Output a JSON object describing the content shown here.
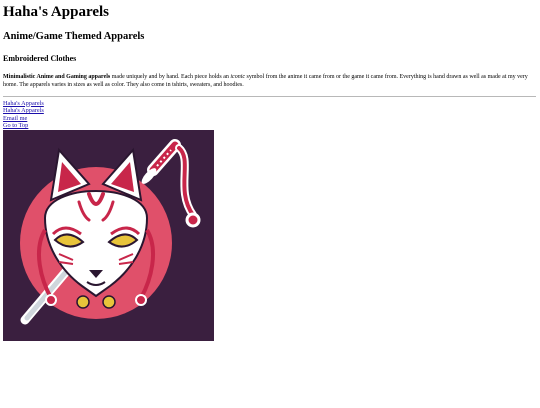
{
  "header": {
    "title": "Haha's Apparels",
    "subtitle": "Anime/Game Themed Apparels",
    "section_heading": "Embroidered Clothes"
  },
  "description": {
    "bold_lead": "Minimalistic Anime and Gaming apparels",
    "part1": " made uniquely and by hand. Each piece holds an ",
    "italic_word": "iconic",
    "part2": " symbol from the anime it came from or the game it came from. Everything is hand drawn as well as made at my very home. The apparels varies in sizes as well as color. They also come in tshirts, sweaters, and hoodies."
  },
  "nav": {
    "links": [
      "Haha's Apparels",
      "Haha's Apparels",
      "Email me",
      "Go to Top"
    ]
  },
  "logo": {
    "icon": "kitsune-mask-katana-icon",
    "colors": {
      "background": "#3a1f3f",
      "circle": "#e0506a",
      "mask": "#ffffff",
      "accent": "#c8264a",
      "eyes": "#e8c43a"
    }
  }
}
